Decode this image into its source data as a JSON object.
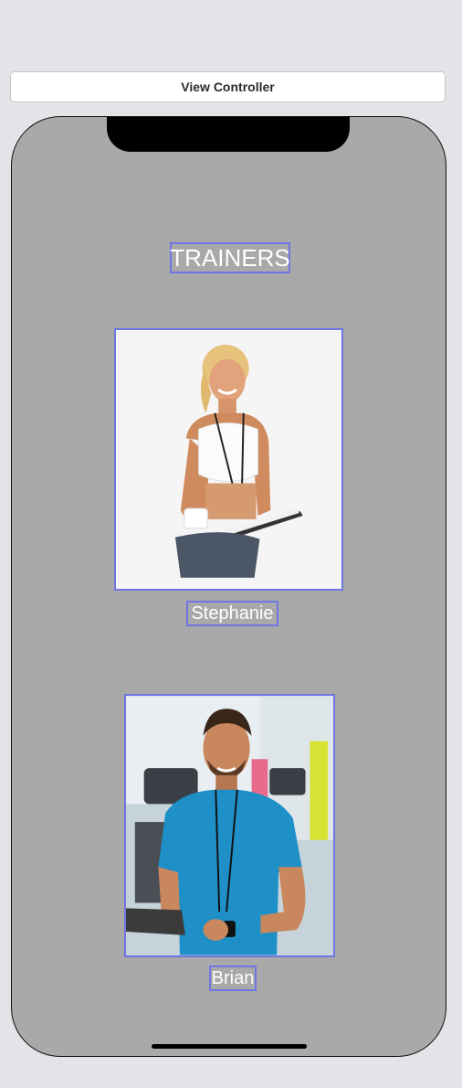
{
  "header": {
    "title": "View Controller"
  },
  "screen": {
    "background_color": "#a9a9a9",
    "heading": "TRAINERS",
    "outline_color": "#6f76e3"
  },
  "trainers": [
    {
      "name": "Stephanie",
      "photo_icon": "trainer-photo"
    },
    {
      "name": "Brian",
      "photo_icon": "trainer-photo"
    }
  ]
}
